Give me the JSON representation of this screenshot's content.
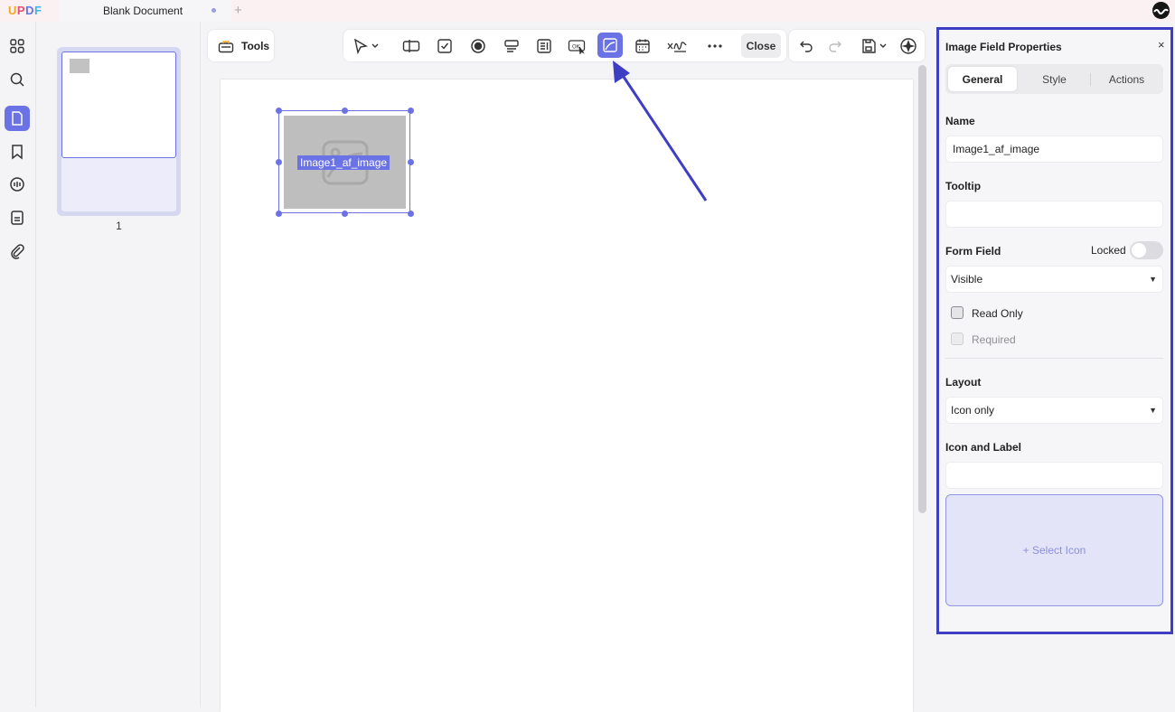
{
  "titlebar": {
    "logo": "UPDF",
    "document_tab": "Blank Document",
    "new_tab": "+"
  },
  "left_rail": {
    "items": [
      "thumbnails-icon",
      "search-icon",
      "pages-icon",
      "bookmark-icon",
      "comment-icon",
      "forms-icon",
      "attachment-icon"
    ],
    "active": "pages-icon"
  },
  "thumbnails": {
    "page_number": "1"
  },
  "toolbar": {
    "tools_label": "Tools",
    "close_label": "Close",
    "active_tool": "image-field-icon"
  },
  "canvas": {
    "field_label": "Image1_af_image"
  },
  "panel": {
    "title": "Image Field Properties",
    "close": "×",
    "tabs": [
      "General",
      "Style",
      "Actions"
    ],
    "active_tab": "General",
    "name_label": "Name",
    "name_value": "Image1_af_image",
    "tooltip_label": "Tooltip",
    "tooltip_value": "",
    "form_field_label": "Form Field",
    "locked_label": "Locked",
    "locked": false,
    "visibility_value": "Visible",
    "read_only_label": "Read Only",
    "required_label": "Required",
    "layout_label": "Layout",
    "layout_value": "Icon only",
    "icon_label_label": "Icon and Label",
    "icon_label_value": "",
    "select_icon": "+ Select Icon"
  },
  "colors": {
    "accent": "#6b72e6",
    "highlight_border": "#3d3ec4"
  }
}
